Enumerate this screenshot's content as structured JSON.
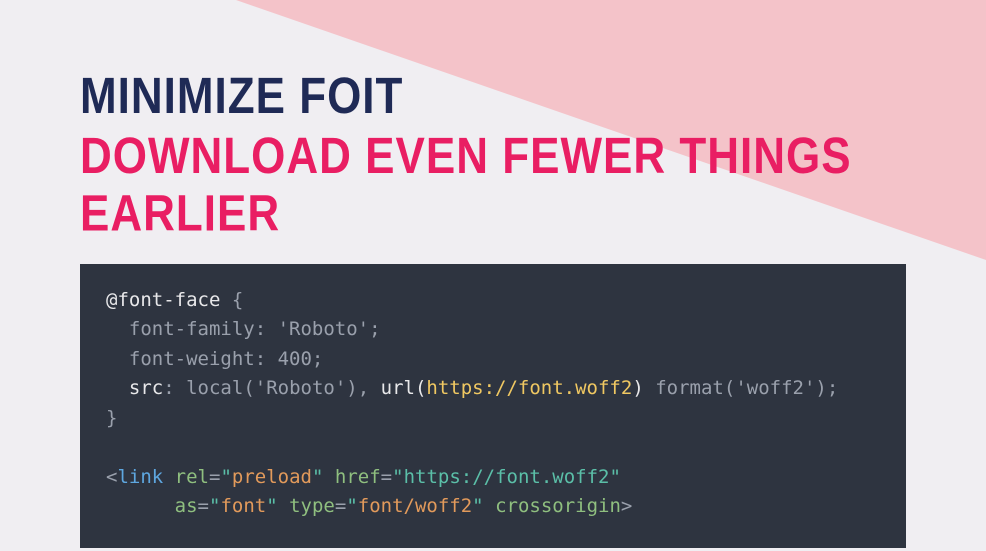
{
  "headings": {
    "line1": "MINIMIZE FOIT",
    "line2": "DOWNLOAD EVEN FEWER THINGS EARLIER"
  },
  "code": {
    "css": {
      "at_rule": "@font-face",
      "brace_open": " {",
      "font_family_prop": "  font-family: ",
      "font_family_val": "'Roboto'",
      "semi": ";",
      "font_weight_prop": "  font-weight: ",
      "font_weight_val": "400",
      "src_indent": "  ",
      "src_prop": "src",
      "colon_sp": ": ",
      "local_fn": "local",
      "local_open": "(",
      "local_arg": "'Roboto'",
      "local_close": ")",
      "comma_sp": ", ",
      "url_fn": "url",
      "url_open": "(",
      "url_arg": "https://font.woff2",
      "url_close": ")",
      "space": " ",
      "format_fn": "format",
      "format_open": "(",
      "format_arg": "'woff2'",
      "format_close": ")",
      "brace_close": "}"
    },
    "html": {
      "lt": "<",
      "tag": "link",
      "sp": " ",
      "rel_attr": "rel",
      "eq": "=",
      "q": "\"",
      "rel_val": "preload",
      "href_attr": "href",
      "href_val": "https://font.woff2",
      "indent": "      ",
      "as_attr": "as",
      "as_val": "font",
      "type_attr": "type",
      "type_val": "font/woff2",
      "crossorigin": "crossorigin",
      "gt": ">"
    }
  }
}
